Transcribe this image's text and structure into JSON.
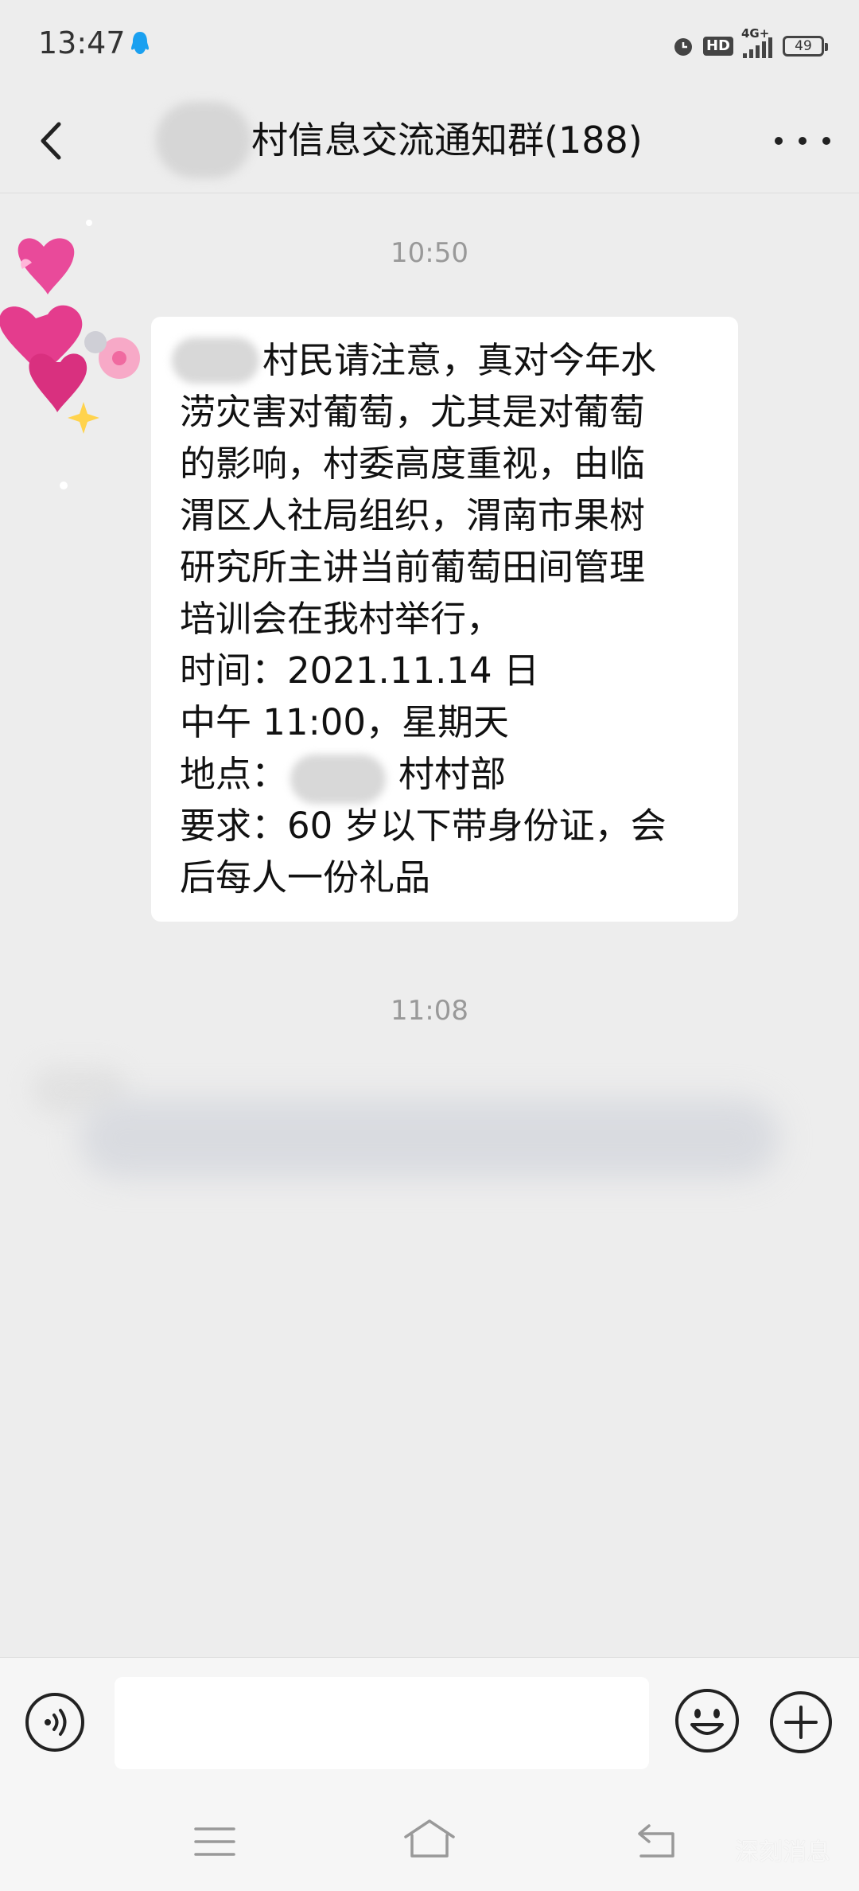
{
  "status_bar": {
    "time": "13:47",
    "hd_label": "HD",
    "network_label": "4G+",
    "battery_level": "49"
  },
  "nav": {
    "title": "村信息交流通知群(188)"
  },
  "messages": [
    {
      "timestamp": "10:50",
      "lines": [
        "村民请注意，真对今年水",
        "涝灾害对葡萄，尤其是对葡萄",
        "的影响，村委高度重视，由临",
        "渭区人社局组织，渭南市果树",
        "研究所主讲当前葡萄田间管理",
        "培训会在我村举行，",
        "时间：2021.11.14 日",
        "中午 11:00，星期天",
        "村村部",
        "要求：60 岁以下带身份证，会",
        "后每人一份礼品"
      ],
      "location_prefix": "地点："
    },
    {
      "timestamp": "11:08"
    }
  ],
  "input": {
    "placeholder": ""
  },
  "watermark": "深刻消息"
}
